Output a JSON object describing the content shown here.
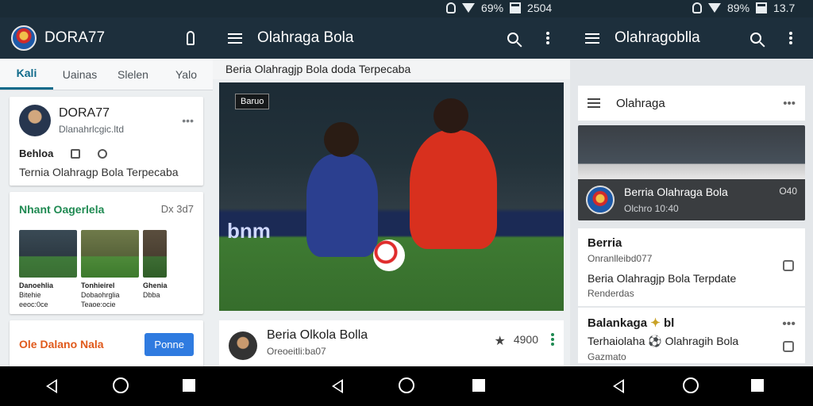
{
  "status_bar": {
    "left_group": {
      "battery": "69%",
      "time": "2504"
    },
    "right_group": {
      "battery": "89%",
      "time": "13.7"
    }
  },
  "panel_left": {
    "app_name": "DORA77",
    "tabs": [
      {
        "label": "Kali",
        "active": true
      },
      {
        "label": "Uainas",
        "active": false
      },
      {
        "label": "Slelen",
        "active": false
      },
      {
        "label": "Yalo",
        "active": false
      }
    ],
    "profile": {
      "name": "DORA77",
      "subtitle": "Dlanahrlcgic.ltd",
      "label": "Behloa",
      "text": "Ternia Olahragp Bola Terpecaba"
    },
    "news": {
      "title": "Nhant Oagerlela",
      "counter": "Dx 3d7",
      "thumbs": [
        {
          "caption_1": "Danoehlia",
          "caption_2": "Bitehie",
          "caption_3": "eeoc:0ce"
        },
        {
          "caption_1": "Tonhieirel",
          "caption_2": "Dobaohrglia",
          "caption_3": "Teaoe:ocie"
        },
        {
          "caption_1": "Ghenia",
          "caption_2": "Dbba",
          "caption_3": ""
        }
      ]
    },
    "bottom_card": {
      "label": "Ole Dalano Nala",
      "button": "Ponne"
    }
  },
  "panel_mid": {
    "title": "Olahraga Bola",
    "subtitle": "Beria Olahragjp Bola  doda Terpecaba",
    "hero_badge": "Baruo",
    "hero_board": "bnm",
    "post": {
      "title": "Beria Olkola Bolla",
      "subtitle": "Oreoeitli:ba07",
      "count": "4900"
    }
  },
  "panel_right": {
    "title": "Olahragoblla",
    "section": "Olahraga",
    "feature": {
      "title": "Berria Olahraga Bola",
      "subtitle": "Olchro 10:40",
      "number": "O40"
    },
    "item1": {
      "title": "Berria",
      "subtitle": "Onranlleibd077",
      "body": "Beria Olahragjp Bola Terpdate",
      "foot": "Renderdas"
    },
    "item2": {
      "title": "Balankaga",
      "title_suffix": "bl",
      "body": "Terhaiolaha",
      "body_suffix": "Olahragih Bola",
      "foot": "Gazmato"
    }
  },
  "colors": {
    "appbar": "#1d2f3c",
    "accent": "#0f6a8a",
    "green": "#1f8a52",
    "orange": "#e05a1c",
    "blue": "#2f7be0"
  },
  "icons": [
    "search-icon",
    "menu-icon",
    "more-vert-icon",
    "key-icon",
    "wifi-icon",
    "battery-icon",
    "alarm-icon",
    "star-icon",
    "share-icon",
    "back-icon",
    "home-icon",
    "recents-icon"
  ]
}
